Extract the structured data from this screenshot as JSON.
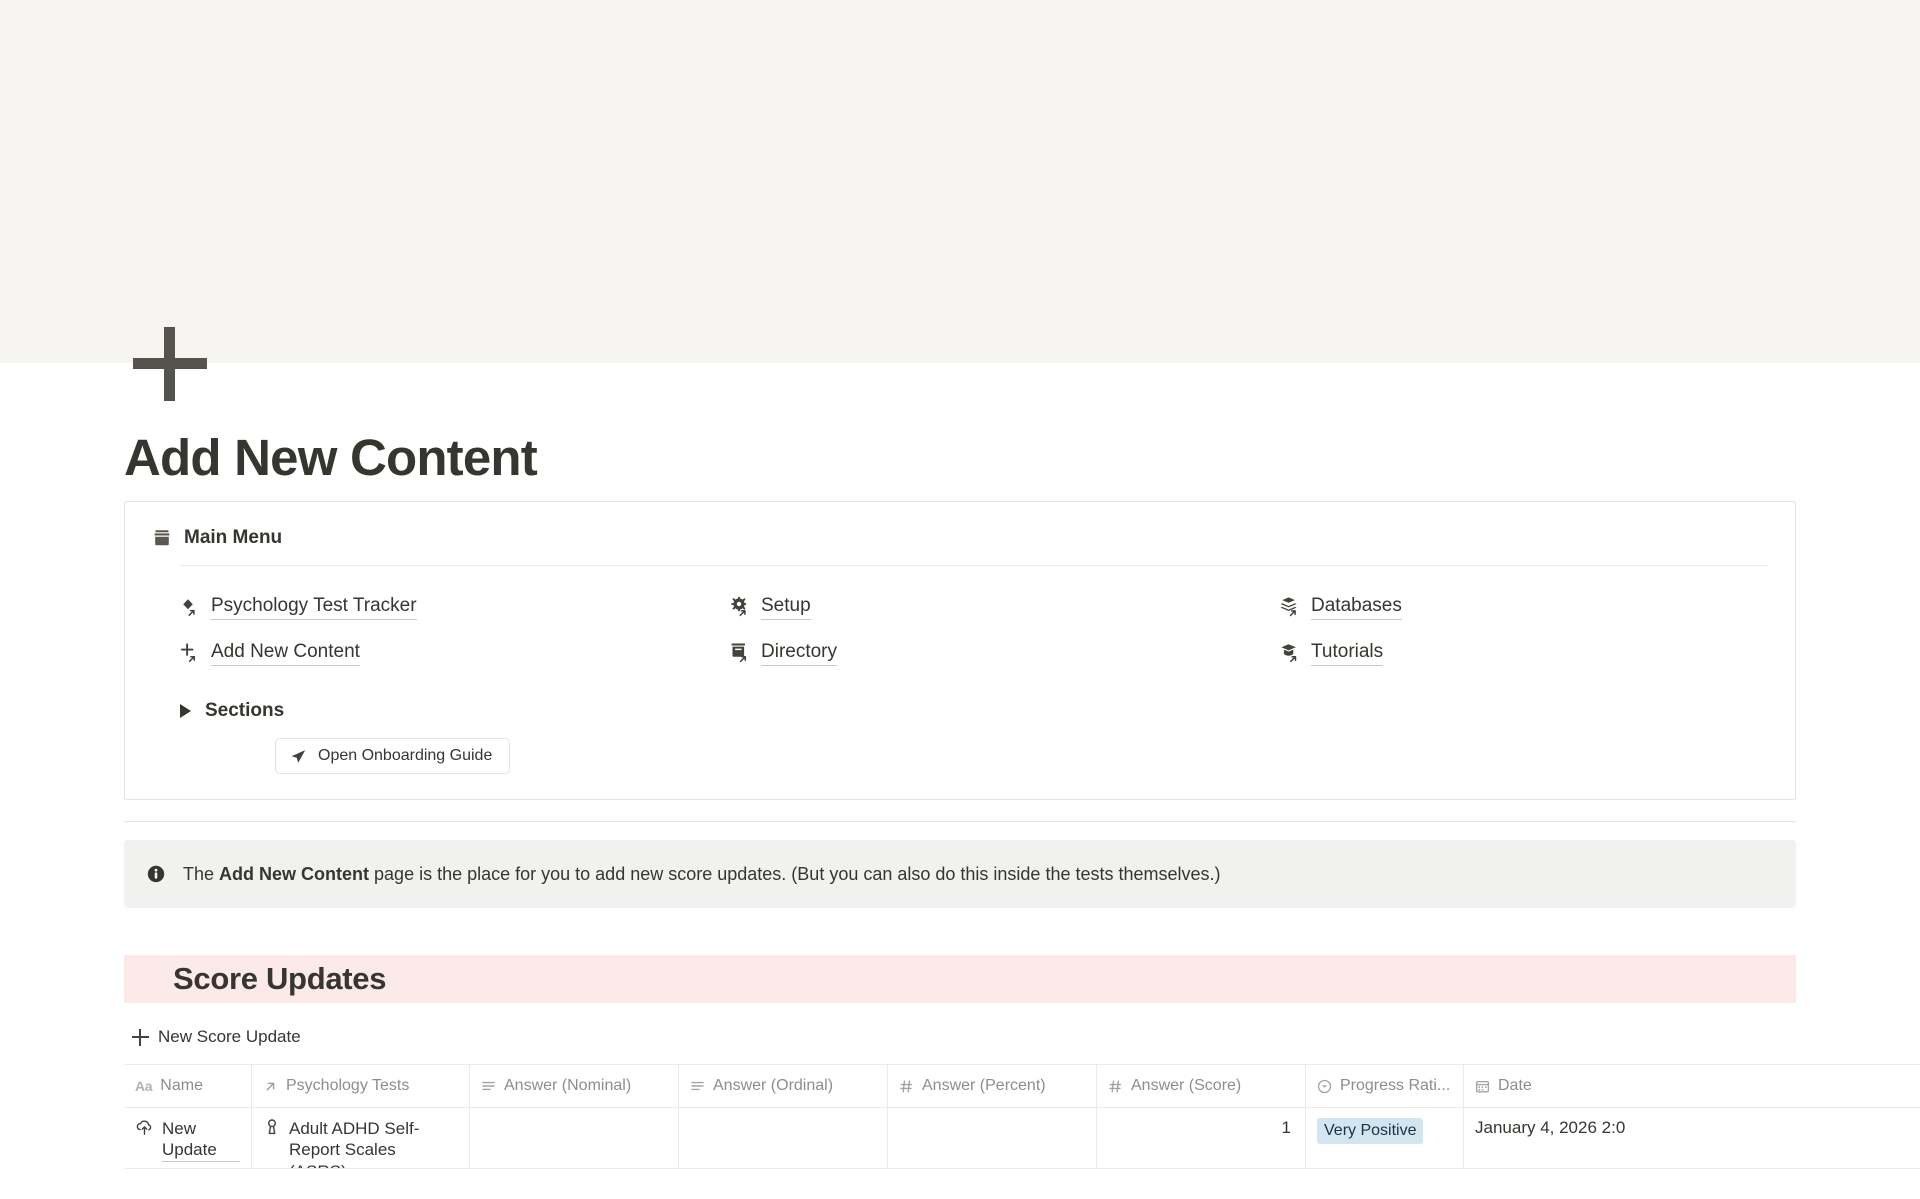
{
  "page": {
    "icon": "plus-icon",
    "title": "Add New Content"
  },
  "menu_card": {
    "header_icon": "archive-box-icon",
    "header_title": "Main Menu",
    "links": [
      {
        "label": "Psychology Test Tracker",
        "icon": "diamond-link-icon"
      },
      {
        "label": "Setup",
        "icon": "gear-link-icon"
      },
      {
        "label": "Databases",
        "icon": "layers-link-icon"
      },
      {
        "label": "Add New Content",
        "icon": "plus-link-icon"
      },
      {
        "label": "Directory",
        "icon": "archive-link-icon"
      },
      {
        "label": "Tutorials",
        "icon": "graduation-cap-link-icon"
      }
    ],
    "sections_label": "Sections",
    "onboarding_button": "Open Onboarding Guide"
  },
  "callout": {
    "icon": "info-icon",
    "text_before": "The ",
    "text_bold": "Add New Content",
    "text_after": " page is the place for you to add new score updates. (But you can also do this inside the tests themselves.)"
  },
  "score_updates": {
    "heading": "Score Updates",
    "new_row_label": "New Score Update",
    "columns": [
      {
        "label": "Name",
        "type_icon": "title-type-icon"
      },
      {
        "label": "Psychology Tests",
        "type_icon": "relation-arrow-icon"
      },
      {
        "label": "Answer (Nominal)",
        "type_icon": "text-lines-icon"
      },
      {
        "label": "Answer (Ordinal)",
        "type_icon": "text-lines-icon"
      },
      {
        "label": "Answer (Percent)",
        "type_icon": "number-hash-icon"
      },
      {
        "label": "Answer (Score)",
        "type_icon": "number-hash-icon"
      },
      {
        "label": "Progress Rati...",
        "type_icon": "select-circle-icon"
      },
      {
        "label": "Date",
        "type_icon": "calendar-icon"
      }
    ],
    "rows": [
      {
        "name": "New Update",
        "name_icon": "cloud-upload-icon",
        "psychology_test": "Adult ADHD Self-Report Scales (ASRS)",
        "test_icon": "person-badge-icon",
        "answer_nominal": "",
        "answer_ordinal": "",
        "answer_percent": "",
        "answer_score": "1",
        "progress_rating": "Very Positive",
        "progress_rating_color": "#d3e5ef",
        "date": "January 4, 2026 2:0"
      }
    ]
  },
  "colors": {
    "cover": "#f6f5f1",
    "section_band": "#fbeae8",
    "callout_bg": "#f1f1ef",
    "text": "#37352f",
    "badge_blue": "#d3e5ef"
  }
}
